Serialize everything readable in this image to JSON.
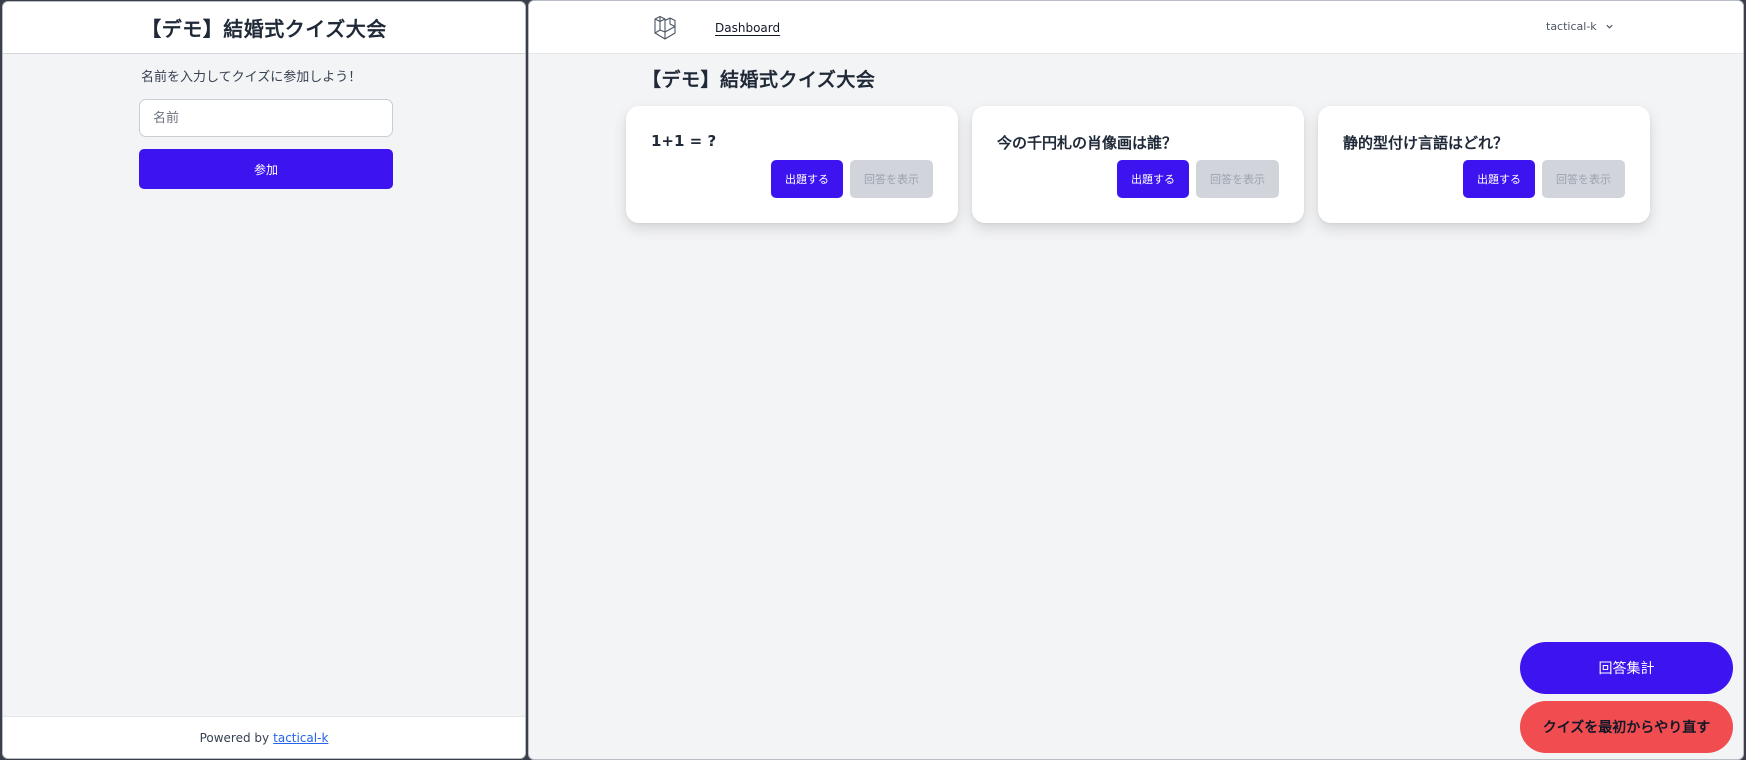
{
  "participant_window": {
    "title": "【デモ】結婚式クイズ大会",
    "join_prompt": "名前を入力してクイズに参加しよう！",
    "name_input": {
      "placeholder": "名前",
      "value": ""
    },
    "join_button": "参加",
    "footer": {
      "powered_by": "Powered by",
      "link_text": "tactical-k"
    }
  },
  "admin_window": {
    "nav": {
      "dashboard": "Dashboard",
      "user_name": "tactical-k",
      "logo_icon": "laravel-logo-icon"
    },
    "heading": "【デモ】結婚式クイズ大会",
    "quizzes": [
      {
        "question": "1+1 = ?",
        "ask_label": "出題する",
        "show_answer_label": "回答を表示"
      },
      {
        "question": "今の千円札の肖像画は誰？",
        "ask_label": "出題する",
        "show_answer_label": "回答を表示"
      },
      {
        "question": "静的型付け言語はどれ？",
        "ask_label": "出題する",
        "show_answer_label": "回答を表示"
      }
    ],
    "tally_button": "回答集計",
    "reset_button": "クイズを最初からやり直す",
    "colors": {
      "primary": "#3d14f0",
      "danger": "#f14d50",
      "disabled": "#d1d5db"
    }
  }
}
